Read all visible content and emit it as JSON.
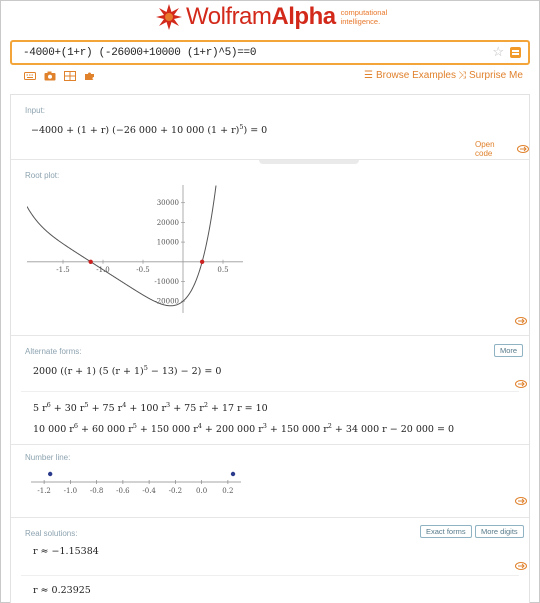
{
  "header": {
    "logo_wolfram": "Wolfram",
    "logo_alpha": "Alpha",
    "tagline_1": "computational",
    "tagline_2": "intelligence.",
    "query": "-4000+(1+r) (-26000+10000 (1+r)^5)==0",
    "browse_examples": "Browse Examples",
    "surprise_me": "Surprise Me",
    "toolbar_icons": [
      "keyboard-icon",
      "camera-icon",
      "grid-icon",
      "puzzle-icon"
    ]
  },
  "pods": {
    "input": {
      "title": "Input:",
      "math": "−4000 + (1 + r) (−26 000 + 10 000 (1 + r)",
      "exp": "5",
      "math_tail": ") = 0",
      "open_code": "Open code"
    },
    "root_plot": {
      "title": "Root plot:"
    },
    "alternate_forms": {
      "title": "Alternate forms:",
      "more": "More",
      "form1": "2000 ((r + 1) (5 (r + 1)",
      "form1_exp": "5",
      "form1_tail": " − 13) − 2) = 0"
    },
    "number_line": {
      "title": "Number line:"
    },
    "real_solutions": {
      "title": "Real solutions:",
      "exact_forms": "Exact forms",
      "more_digits": "More digits",
      "sol1": "r ≈ −1.15384",
      "sol2": "r ≈ 0.23925"
    }
  },
  "chart_data": [
    {
      "type": "line",
      "name": "root plot",
      "function": "-4000+(1+r)(-26000+10000(1+r)^5)",
      "xlim": [
        -1.95,
        0.75
      ],
      "ylim": [
        -26000,
        40000
      ],
      "x_ticks": [
        -1.5,
        -1.0,
        -0.5,
        0.5
      ],
      "x_tick_labels": [
        "-1.5",
        "-1.0",
        "-0.5",
        "0.5"
      ],
      "y_ticks": [
        30000,
        20000,
        10000,
        -10000,
        -20000
      ],
      "y_tick_labels": [
        "30000",
        "20000",
        "10000",
        "-10000",
        "-20000"
      ],
      "roots": [
        -1.15384,
        0.23925
      ],
      "line_color": "#555555",
      "root_color": "#cc2222"
    },
    {
      "type": "scatter",
      "name": "number line",
      "xlim": [
        -1.3,
        0.3
      ],
      "x_ticks": [
        -1.2,
        -1.0,
        -0.8,
        -0.6,
        -0.4,
        -0.2,
        0.0,
        0.2
      ],
      "x_tick_labels": [
        "-1.2",
        "-1.0",
        "-0.8",
        "-0.6",
        "-0.4",
        "-0.2",
        "0.0",
        "0.2"
      ],
      "points": [
        -1.15384,
        0.23925
      ],
      "point_color": "#2a3a8c"
    }
  ],
  "colors": {
    "brand_red": "#d2291b",
    "accent_orange": "#e0812c",
    "search_border": "#f4a53a",
    "pod_title": "#8da3b0"
  }
}
